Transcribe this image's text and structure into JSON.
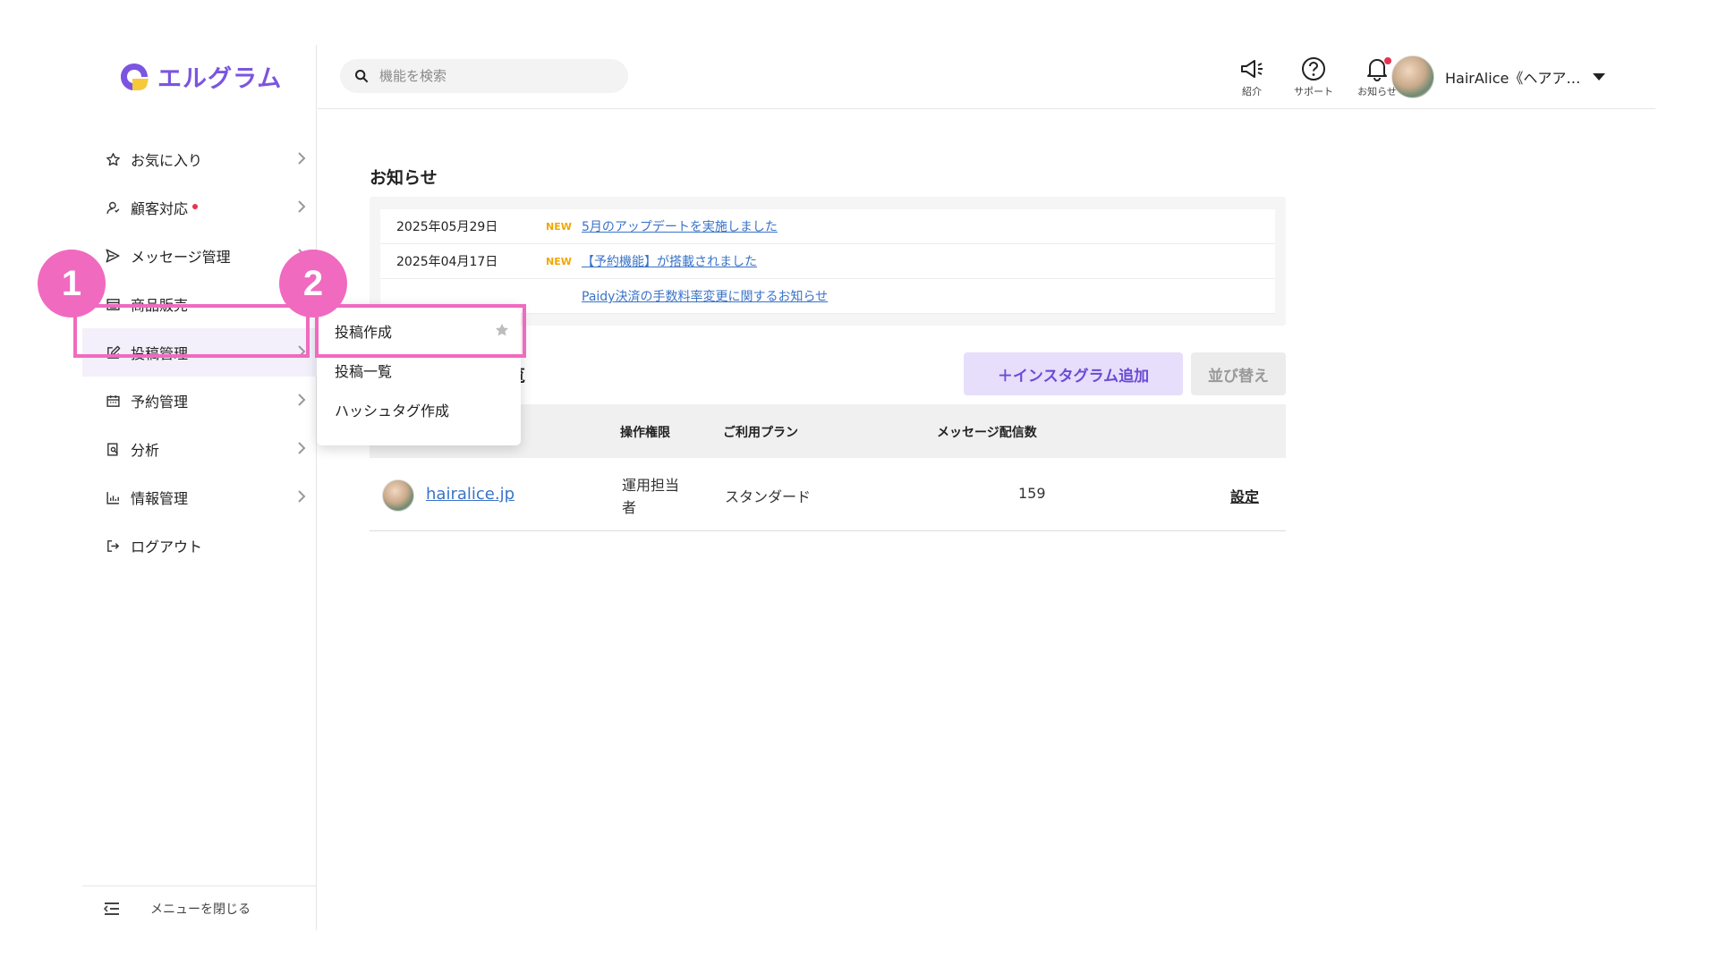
{
  "colors": {
    "brand": "#7b55e0",
    "link": "#3a73c8",
    "highlight": "#f06ac0",
    "alert": "#e8334d",
    "new_tag": "#f0a800"
  },
  "logo": {
    "text": "エルグラム"
  },
  "sidebar": {
    "items": [
      {
        "label": "お気に入り",
        "icon": "star-icon"
      },
      {
        "label": "顧客対応",
        "icon": "person-icon",
        "dot": true
      },
      {
        "label": "メッセージ管理",
        "icon": "send-icon"
      },
      {
        "label": "商品販売",
        "icon": "store-icon"
      },
      {
        "label": "投稿管理",
        "icon": "edit-icon",
        "active": true
      },
      {
        "label": "予約管理",
        "icon": "calendar-icon"
      },
      {
        "label": "分析",
        "icon": "report-icon"
      },
      {
        "label": "情報管理",
        "icon": "bar-chart-icon"
      },
      {
        "label": "ログアウト",
        "icon": "logout-icon"
      }
    ],
    "close_label": "メニューを閉じる"
  },
  "topbar": {
    "search_placeholder": "機能を検索",
    "referral_label": "紹介",
    "support_label": "サポート",
    "notifications_label": "お知らせ",
    "user_name": "HairAlice《ヘアア…"
  },
  "notices": {
    "title": "お知らせ",
    "items": [
      {
        "date": "2025年05月29日",
        "new": "NEW",
        "text": "5月のアップデートを実施しました"
      },
      {
        "date": "2025年04月17日",
        "new": "NEW",
        "text": "【予約機能】が搭載されました"
      },
      {
        "date": "",
        "new": "",
        "text": "Paidy決済の手数料率変更に関するお知らせ"
      }
    ]
  },
  "accounts": {
    "title_fragment": "覧",
    "add_button": "＋インスタグラム追加",
    "sort_button": "並び替え",
    "columns": {
      "permission": "操作権限",
      "plan": "ご利用プラン",
      "messages": "メッセージ配信数"
    },
    "rows": [
      {
        "name": "hairalice.jp",
        "permission": "運用担当者",
        "plan": "スタンダード",
        "messages": "159",
        "settings": "設定"
      }
    ]
  },
  "submenu": {
    "items": [
      {
        "label": "投稿作成"
      },
      {
        "label": "投稿一覧"
      },
      {
        "label": "ハッシュタグ作成"
      }
    ]
  },
  "annotations": {
    "step1": "1",
    "step2": "2"
  }
}
